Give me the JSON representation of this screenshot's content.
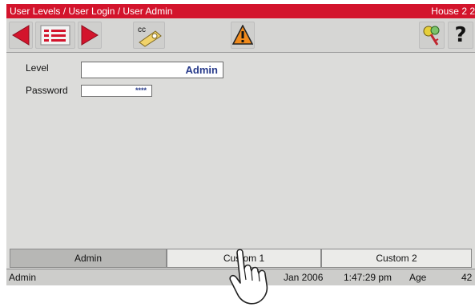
{
  "titlebar": {
    "breadcrumb": "User Levels / User Login / User Admin",
    "house": "House 2 2"
  },
  "toolbar": {
    "icons": [
      "arrow-left-icon",
      "list-icon",
      "arrow-right-icon",
      "cc-key-icon",
      "warning-icon",
      "keys-icon",
      "help-icon"
    ],
    "help_label": "?",
    "cc_label": "cc"
  },
  "form": {
    "level_label": "Level",
    "level_value": "Admin",
    "password_label": "Password",
    "password_value": "****"
  },
  "tabs": [
    {
      "label": "Admin",
      "active": true
    },
    {
      "label": "Custom 1",
      "active": false
    },
    {
      "label": "Custom 2",
      "active": false
    }
  ],
  "status": {
    "user": "Admin",
    "date": "Jan 2006",
    "time": "1:47:29 pm",
    "age_label": "Age",
    "age_value": "42"
  },
  "colors": {
    "titlebar": "#d3142c",
    "arrow": "#d3142c",
    "warning": "#f08a1c",
    "field_text": "#273a8a"
  }
}
